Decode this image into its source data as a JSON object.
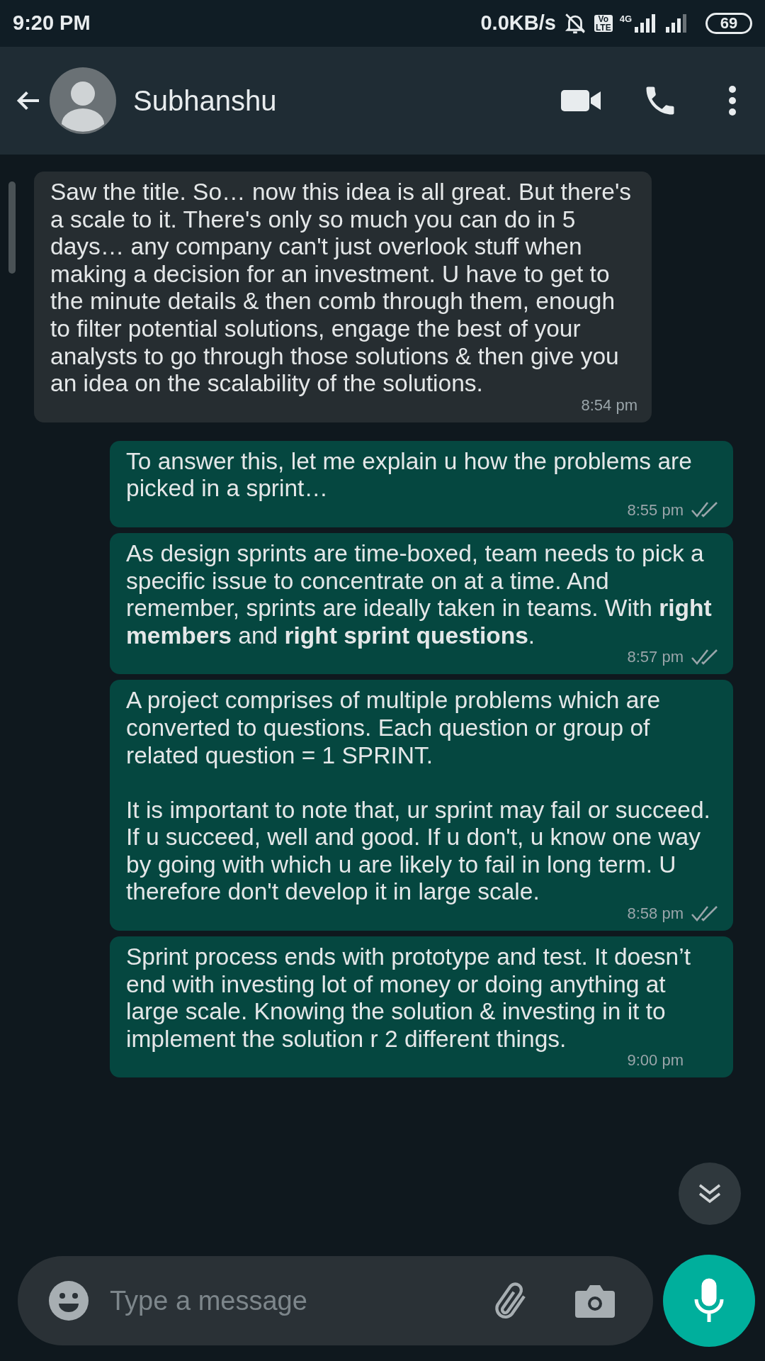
{
  "status_bar": {
    "time": "9:20 PM",
    "speed": "0.0KB/s",
    "volte": [
      "Vo",
      "LTE"
    ],
    "network": "4G",
    "battery": "69"
  },
  "header": {
    "contact": "Subhanshu"
  },
  "messages": [
    {
      "kind": "incoming",
      "text": "Saw the title. So… now this idea is all great. But there's a scale to it. There's only so much you can do in 5 days… any company can't just overlook stuff when making a decision for an investment. U have to get to the minute details & then comb through them, enough to filter potential solutions, engage the best of your analysts to go through those solutions & then give you an idea on the scalability of the solutions.",
      "time": "8:54 pm"
    },
    {
      "kind": "outgoing",
      "text": "To answer this, let me explain u how the problems are picked in a sprint…",
      "time": "8:55 pm",
      "read": true
    },
    {
      "kind": "outgoing",
      "text": "As design sprints are time-boxed, team needs to pick a specific issue to concentrate on at a time. And remember, sprints are ideally taken in teams. With **right members** and **right sprint questions**.",
      "time": "8:57 pm",
      "read": true
    },
    {
      "kind": "outgoing",
      "text": "A project comprises of multiple problems which are converted to questions. Each question or group of related question = 1 SPRINT.\n\nIt is important to note that, ur sprint may fail or succeed. If u succeed, well and good. If u don't, u know one way by going with which u are likely to fail in long term. U therefore don't develop it in large scale.",
      "time": "8:58 pm",
      "read": true
    },
    {
      "kind": "outgoing",
      "text": "Sprint process ends with prototype and test. It doesn’t end with investing lot of money or doing anything at large scale. Knowing the solution & investing in it to implement the solution r 2 different things.",
      "time": "9:00 pm",
      "read": false
    }
  ],
  "composer": {
    "placeholder": "Type a message"
  }
}
